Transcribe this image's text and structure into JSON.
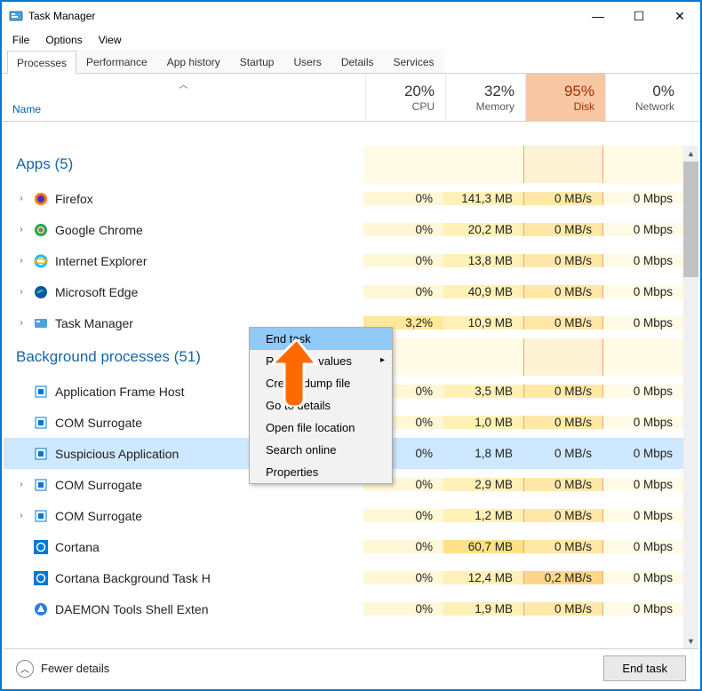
{
  "window": {
    "title": "Task Manager",
    "controls": {
      "min": "—",
      "max": "☐",
      "close": "✕"
    }
  },
  "menu": {
    "file": "File",
    "options": "Options",
    "view": "View"
  },
  "tabs": {
    "processes": "Processes",
    "performance": "Performance",
    "app_history": "App history",
    "startup": "Startup",
    "users": "Users",
    "details": "Details",
    "services": "Services"
  },
  "columns": {
    "name": "Name",
    "cpu_pct": "20%",
    "cpu_label": "CPU",
    "mem_pct": "32%",
    "mem_label": "Memory",
    "disk_pct": "95%",
    "disk_label": "Disk",
    "net_pct": "0%",
    "net_label": "Network"
  },
  "groups": {
    "apps": "Apps (5)",
    "bg": "Background processes (51)"
  },
  "rows": {
    "firefox": {
      "name": "Firefox",
      "cpu": "0%",
      "mem": "141,3 MB",
      "disk": "0 MB/s",
      "net": "0 Mbps"
    },
    "chrome": {
      "name": "Google Chrome",
      "cpu": "0%",
      "mem": "20,2 MB",
      "disk": "0 MB/s",
      "net": "0 Mbps"
    },
    "ie": {
      "name": "Internet Explorer",
      "cpu": "0%",
      "mem": "13,8 MB",
      "disk": "0 MB/s",
      "net": "0 Mbps"
    },
    "edge": {
      "name": "Microsoft Edge",
      "cpu": "0%",
      "mem": "40,9 MB",
      "disk": "0 MB/s",
      "net": "0 Mbps"
    },
    "taskmgr": {
      "name": "Task Manager",
      "cpu": "3,2%",
      "mem": "10,9 MB",
      "disk": "0 MB/s",
      "net": "0 Mbps"
    },
    "afh": {
      "name": "Application Frame Host",
      "cpu": "0%",
      "mem": "3,5 MB",
      "disk": "0 MB/s",
      "net": "0 Mbps"
    },
    "coms1": {
      "name": "COM Surrogate",
      "cpu": "0%",
      "mem": "1,0 MB",
      "disk": "0 MB/s",
      "net": "0 Mbps"
    },
    "susp": {
      "name": "Suspicious Application",
      "cpu": "0%",
      "mem": "1,8 MB",
      "disk": "0 MB/s",
      "net": "0 Mbps"
    },
    "coms2": {
      "name": "COM Surrogate",
      "cpu": "0%",
      "mem": "2,9 MB",
      "disk": "0 MB/s",
      "net": "0 Mbps"
    },
    "coms3": {
      "name": "COM Surrogate",
      "cpu": "0%",
      "mem": "1,2 MB",
      "disk": "0 MB/s",
      "net": "0 Mbps"
    },
    "cortana": {
      "name": "Cortana",
      "cpu": "0%",
      "mem": "60,7 MB",
      "disk": "0 MB/s",
      "net": "0 Mbps"
    },
    "cortanabg": {
      "name": "Cortana Background Task H",
      "cpu": "0%",
      "mem": "12,4 MB",
      "disk": "0,2 MB/s",
      "net": "0 Mbps"
    },
    "daemon": {
      "name": "DAEMON Tools Shell Exten",
      "cpu": "0%",
      "mem": "1,9 MB",
      "disk": "0 MB/s",
      "net": "0 Mbps"
    }
  },
  "context_menu": {
    "end_task": "End task",
    "resource_values": "Resource values",
    "create_dump": "Create dump file",
    "go_details": "Go to details",
    "open_loc": "Open file location",
    "search": "Search online",
    "props": "Properties"
  },
  "footer": {
    "fewer": "Fewer details",
    "end_task": "End task"
  }
}
